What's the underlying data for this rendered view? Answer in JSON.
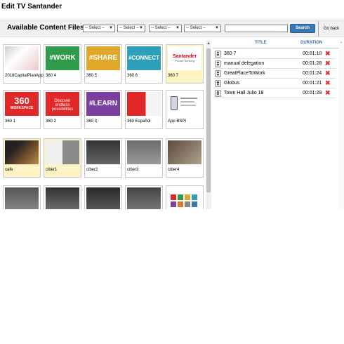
{
  "page_title": "Edit TV Santander",
  "toolbar": {
    "heading": "Available Content Files",
    "filters": [
      "-- Select --",
      "-- Select --",
      "-- Select --",
      "-- Select --"
    ],
    "search_value": "",
    "search_label": "Search",
    "back_label": "Go back"
  },
  "tiles": [
    {
      "caption": "2018CapitalPlanAppro",
      "thumb_text": "",
      "highlight": false
    },
    {
      "caption": "360 4",
      "thumb_text": "#WORK",
      "highlight": false
    },
    {
      "caption": "360 5",
      "thumb_text": "#SHARE",
      "highlight": false
    },
    {
      "caption": "360 6",
      "thumb_text": "#CONNECT",
      "highlight": false
    },
    {
      "caption": "360 7",
      "thumb_text": "Santander",
      "thumb_sub": "Private Banking",
      "highlight": true
    },
    {
      "caption": "360 1",
      "thumb_text": "360",
      "thumb_sub": "WORKSPACE",
      "highlight": false
    },
    {
      "caption": "360 2",
      "thumb_text": "Discover endless possibilities",
      "highlight": false
    },
    {
      "caption": "360 3",
      "thumb_text": "#LEARN",
      "highlight": false
    },
    {
      "caption": "360 Español",
      "thumb_text": "",
      "highlight": false
    },
    {
      "caption": "App BSPI",
      "thumb_text": "",
      "highlight": false
    },
    {
      "caption": "cafe",
      "thumb_text": "",
      "highlight": true
    },
    {
      "caption": "ciber1",
      "thumb_text": "",
      "highlight": true
    },
    {
      "caption": "ciber2",
      "thumb_text": "",
      "highlight": false
    },
    {
      "caption": "ciber3",
      "thumb_text": "",
      "highlight": false
    },
    {
      "caption": "ciber4",
      "thumb_text": "",
      "highlight": false
    },
    {
      "caption": "",
      "thumb_text": "",
      "highlight": false
    },
    {
      "caption": "",
      "thumb_text": "",
      "highlight": false
    },
    {
      "caption": "",
      "thumb_text": "",
      "highlight": false
    },
    {
      "caption": "",
      "thumb_text": "",
      "highlight": false
    },
    {
      "caption": "",
      "thumb_text": "",
      "highlight": false
    }
  ],
  "playlist": {
    "title_header": "TITLE",
    "duration_header": "DURATION",
    "rows": [
      {
        "title": "360 7",
        "duration": "00:01:10"
      },
      {
        "title": "manual delegation",
        "duration": "00:01:28"
      },
      {
        "title": "GreatPlaceToWork",
        "duration": "00:01:24"
      },
      {
        "title": "Globus",
        "duration": "00:01:21"
      },
      {
        "title": "Town Hall Julio 18",
        "duration": "00:01:29"
      }
    ]
  },
  "colors": {
    "search": "#3c78b0",
    "delete": "#dd3333",
    "header_text": "#3a6ea5",
    "highlight": "#fdf3c5"
  }
}
